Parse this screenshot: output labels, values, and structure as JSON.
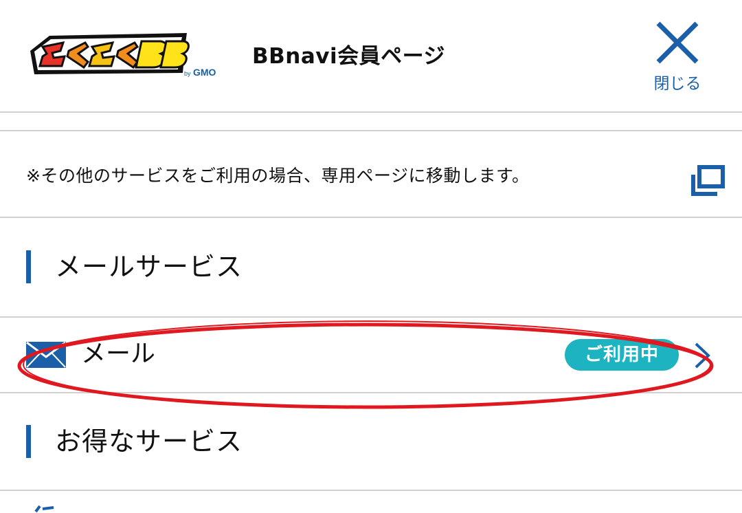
{
  "header": {
    "logo_text": "とくとくBB",
    "logo_sub": "by GMO",
    "title": "BBnavi会員ページ",
    "close_label": "閉じる",
    "close_icon": "close-x-icon"
  },
  "notice": {
    "text": "※その他のサービスをご利用の場合、専用ページに移動します。",
    "icon": "external-window-icon"
  },
  "sections": [
    {
      "title": "メールサービス"
    },
    {
      "title": "お得なサービス"
    }
  ],
  "mail_item": {
    "label": "メール",
    "badge": "ご利用中",
    "icon": "envelope-icon"
  },
  "colors": {
    "accent_blue": "#1a5fa8",
    "badge_teal": "#1eb3c0",
    "annotation_red": "#e0181f",
    "divider": "#d0d0d0"
  }
}
